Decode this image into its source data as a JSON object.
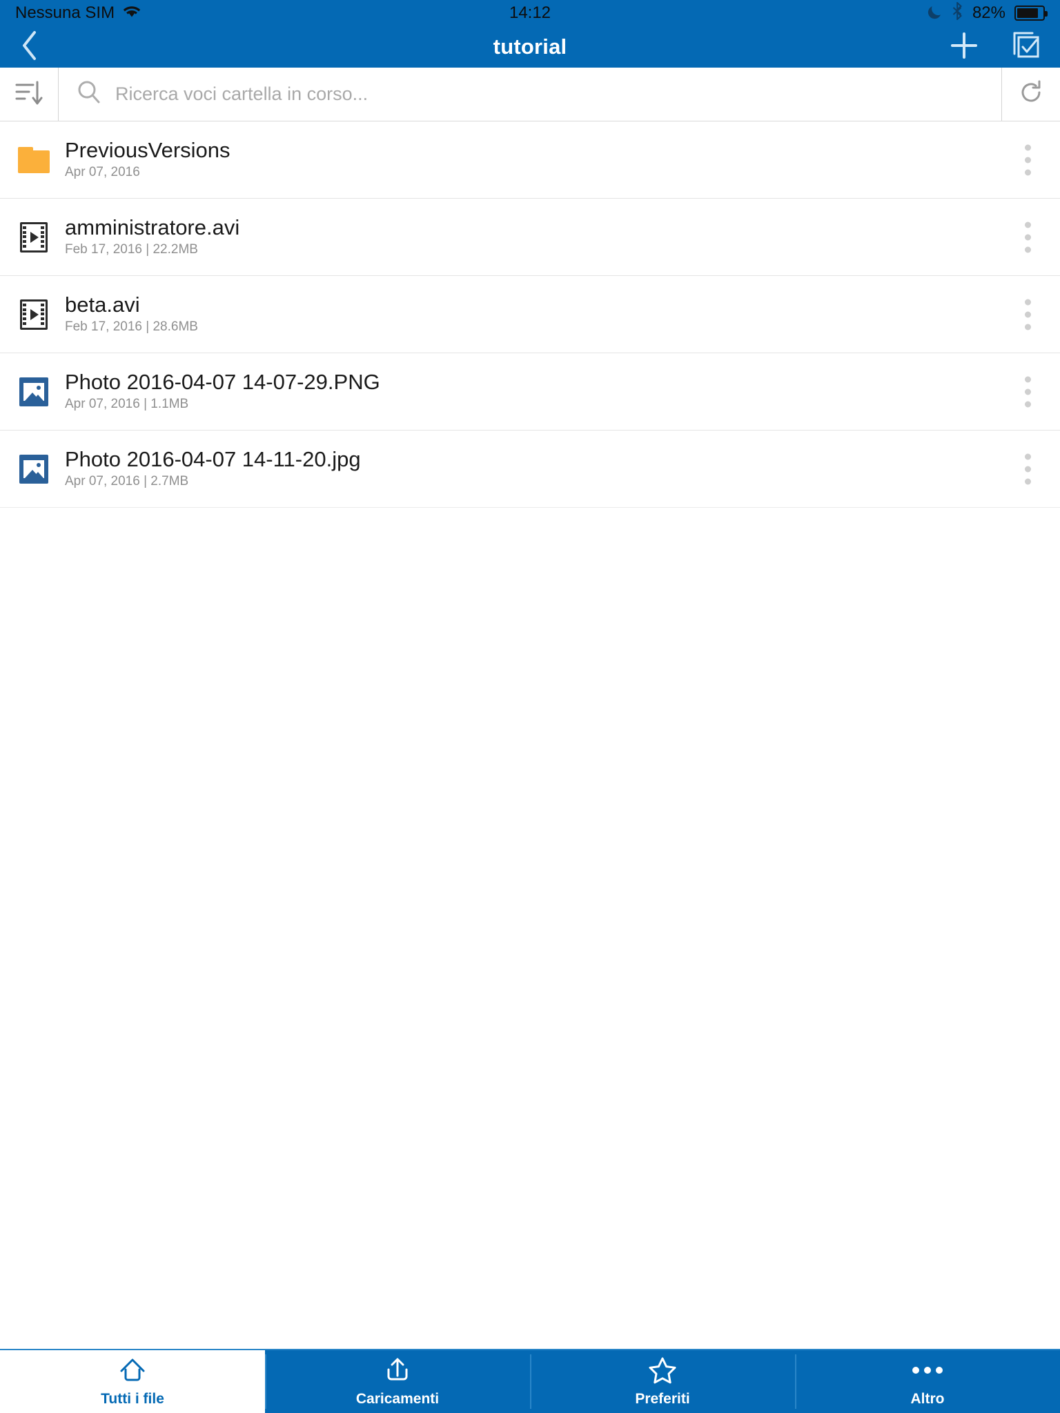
{
  "status_bar": {
    "carrier": "Nessuna SIM",
    "wifi_icon": "wifi-icon",
    "time": "14:12",
    "dnd_icon": "moon-icon",
    "bluetooth_icon": "bluetooth-icon",
    "battery_percent": "82%",
    "battery_icon": "battery-icon"
  },
  "nav_bar": {
    "back_icon": "chevron-left-icon",
    "title": "tutorial",
    "add_icon": "plus-icon",
    "select_icon": "multi-select-icon"
  },
  "toolbar": {
    "sort_icon": "sort-descending-icon",
    "search_icon": "search-icon",
    "search_value": "",
    "search_placeholder": "Ricerca voci cartella in corso...",
    "refresh_icon": "refresh-icon"
  },
  "files": [
    {
      "icon": "folder-icon",
      "name": "PreviousVersions",
      "meta": "Apr 07, 2016",
      "more_icon": "more-vertical-icon"
    },
    {
      "icon": "video-file-icon",
      "name": "amministratore.avi",
      "meta": "Feb 17, 2016 | 22.2MB",
      "more_icon": "more-vertical-icon"
    },
    {
      "icon": "video-file-icon",
      "name": "beta.avi",
      "meta": "Feb 17, 2016 | 28.6MB",
      "more_icon": "more-vertical-icon"
    },
    {
      "icon": "image-file-icon",
      "name": "Photo 2016-04-07 14-07-29.PNG",
      "meta": "Apr 07, 2016 | 1.1MB",
      "more_icon": "more-vertical-icon"
    },
    {
      "icon": "image-file-icon",
      "name": "Photo 2016-04-07 14-11-20.jpg",
      "meta": "Apr 07, 2016 | 2.7MB",
      "more_icon": "more-vertical-icon"
    }
  ],
  "tab_bar": {
    "tabs": [
      {
        "label": "Tutti i file",
        "icon": "home-icon",
        "active": true
      },
      {
        "label": "Caricamenti",
        "icon": "upload-icon",
        "active": false
      },
      {
        "label": "Preferiti",
        "icon": "star-icon",
        "active": false
      },
      {
        "label": "Altro",
        "icon": "more-horizontal-icon",
        "active": false
      }
    ]
  },
  "colors": {
    "brand_blue": "#0469b4",
    "folder_amber": "#fbb03b",
    "image_blue": "#2a6099",
    "meta_gray": "#8f8f8f",
    "placeholder_gray": "#a9a9a9"
  }
}
